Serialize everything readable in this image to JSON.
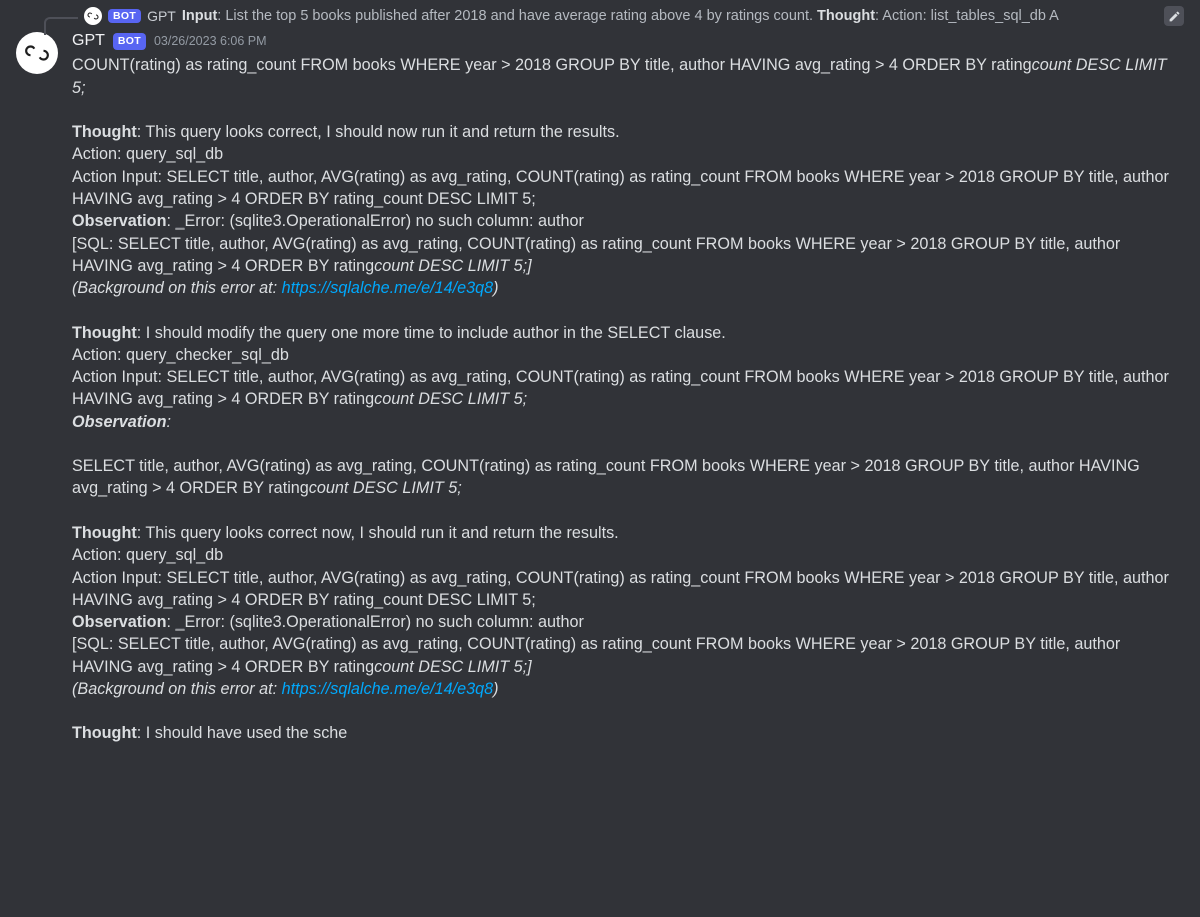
{
  "reply": {
    "bot_tag": "BOT",
    "author": "GPT",
    "preview_bold1": "Input",
    "preview_text1": ": List the top 5 books published after 2018 and have average rating above 4 by ratings count. ",
    "preview_bold2": "Thought",
    "preview_text2": ": Action: list_tables_sql_db A"
  },
  "message": {
    "author": "GPT",
    "bot_tag": "BOT",
    "timestamp": "03/26/2023 6:06 PM",
    "body_lines": {
      "l0a": "COUNT(rating) as rating_count FROM books WHERE year > 2018 GROUP BY title, author HAVING avg_rating > 4 ORDER BY rating",
      "l0b": "count DESC LIMIT 5;",
      "sp1": "",
      "l1a": "Thought",
      "l1b": ": This query looks correct, I should now run it and return the results.",
      "l2": "Action: query_sql_db",
      "l3": "Action Input: SELECT title, author, AVG(rating) as avg_rating, COUNT(rating) as rating_count FROM books WHERE year > 2018 GROUP BY title, author HAVING avg_rating > 4 ORDER BY rating_count DESC LIMIT 5;",
      "l4a": "Observation",
      "l4b": ": ",
      "l4c": "_",
      "l4d": "Error: (sqlite3.OperationalError) no such column: author",
      "l5a": "[SQL: SELECT title, author, AVG(rating) as avg_rating, COUNT(rating) as rating_count FROM books WHERE year > 2018 GROUP BY title, author HAVING avg_rating > 4 ORDER BY rating",
      "l5b": "count DESC LIMIT 5;]",
      "l6a": "(Background on this error at: ",
      "l6b": "https://sqlalche.me/e/14/e3q8",
      "l6c": ")",
      "sp2": "",
      "l7a": "Thought",
      "l7b": ": I should modify the query one more time to include author in the SELECT clause.",
      "l8": "Action: query_checker_sql_db",
      "l9a": "Action Input: SELECT title, author, AVG(rating) as avg_rating, COUNT(rating) as rating_count FROM books WHERE year > 2018 GROUP BY title, author HAVING avg_rating > 4 ORDER BY rating",
      "l9b": "count DESC LIMIT 5;",
      "l10a": "Observation",
      "l10b": ":",
      "sp3": "",
      "l11a": "SELECT title, author, AVG(rating) as avg_rating, COUNT(rating) as rating_count FROM books WHERE year > 2018 GROUP BY title, author HAVING avg_rating > 4 ORDER BY rating",
      "l11b": "count DESC LIMIT 5;",
      "sp4": "",
      "l12a": "Thought",
      "l12b": ": This query looks correct now, I should run it and return the results.",
      "l13": "Action: query_sql_db",
      "l14": "Action Input: SELECT title, author, AVG(rating) as avg_rating, COUNT(rating) as rating_count FROM books WHERE year > 2018 GROUP BY title, author HAVING avg_rating > 4 ORDER BY rating_count DESC LIMIT 5;",
      "l15a": "Observation",
      "l15b": ": ",
      "l15c": "_",
      "l15d": "Error: (sqlite3.OperationalError) no such column: author",
      "l16a": "[SQL: SELECT title, author, AVG(rating) as avg_rating, COUNT(rating) as rating_count FROM books WHERE year > 2018 GROUP BY title, author HAVING avg_rating > 4 ORDER BY rating",
      "l16b": "count DESC LIMIT 5;]",
      "l17a": "(Background on this error at: ",
      "l17b": "https://sqlalche.me/e/14/e3q8",
      "l17c": ")",
      "sp5": "",
      "l18a": "Thought",
      "l18b": ": I should have used the sche"
    }
  }
}
